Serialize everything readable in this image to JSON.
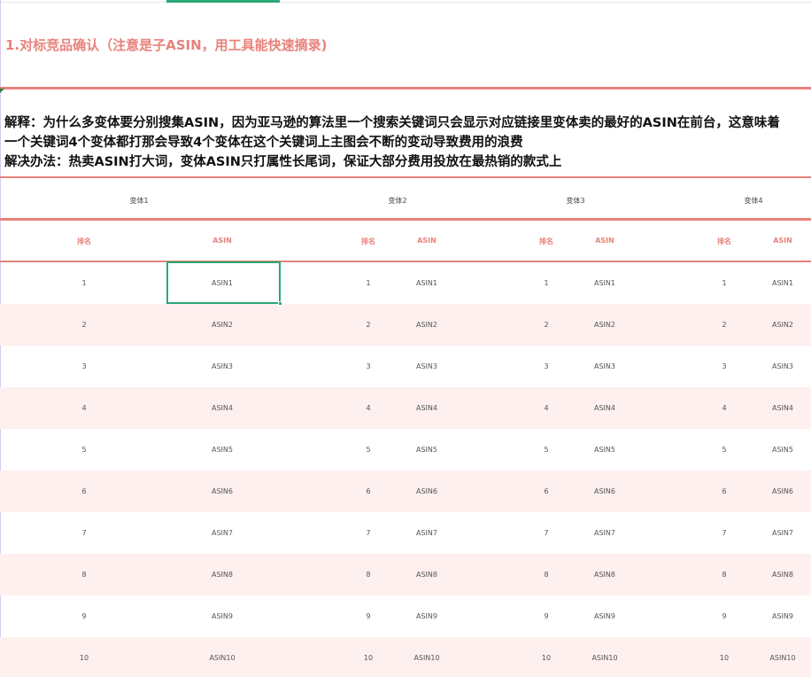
{
  "heading": "1.对标竞品确认（注意是子ASIN，用工具能快速摘录)",
  "explanation": {
    "line1": "解释：为什么多变体要分别搜集ASIN，因为亚马逊的算法里一个搜索关键词只会显示对应链接里变体卖的最好的ASIN在前台，这意味着",
    "line2": "一个关键词4个变体都打那会导致4个变体在这个关键词上主图会不断的变动导致费用的浪费",
    "line3": "解决办法：热卖ASIN打大词，变体ASIN只打属性长尾词，保证大部分费用投放在最热销的款式上"
  },
  "table": {
    "variants": [
      "变体1",
      "变体2",
      "变体3",
      "变体4"
    ],
    "rank_header": "排名",
    "asin_header": "ASIN",
    "rows": [
      {
        "rank": "1",
        "asin": "ASIN1"
      },
      {
        "rank": "2",
        "asin": "ASIN2"
      },
      {
        "rank": "3",
        "asin": "ASIN3"
      },
      {
        "rank": "4",
        "asin": "ASIN4"
      },
      {
        "rank": "5",
        "asin": "ASIN5"
      },
      {
        "rank": "6",
        "asin": "ASIN6"
      },
      {
        "rank": "7",
        "asin": "ASIN7"
      },
      {
        "rank": "8",
        "asin": "ASIN8"
      },
      {
        "rank": "9",
        "asin": "ASIN9"
      },
      {
        "rank": "10",
        "asin": "ASIN10"
      }
    ]
  },
  "colors": {
    "accent": "#e8827c",
    "selection": "#2aa876",
    "band": "#fdf0ef"
  }
}
